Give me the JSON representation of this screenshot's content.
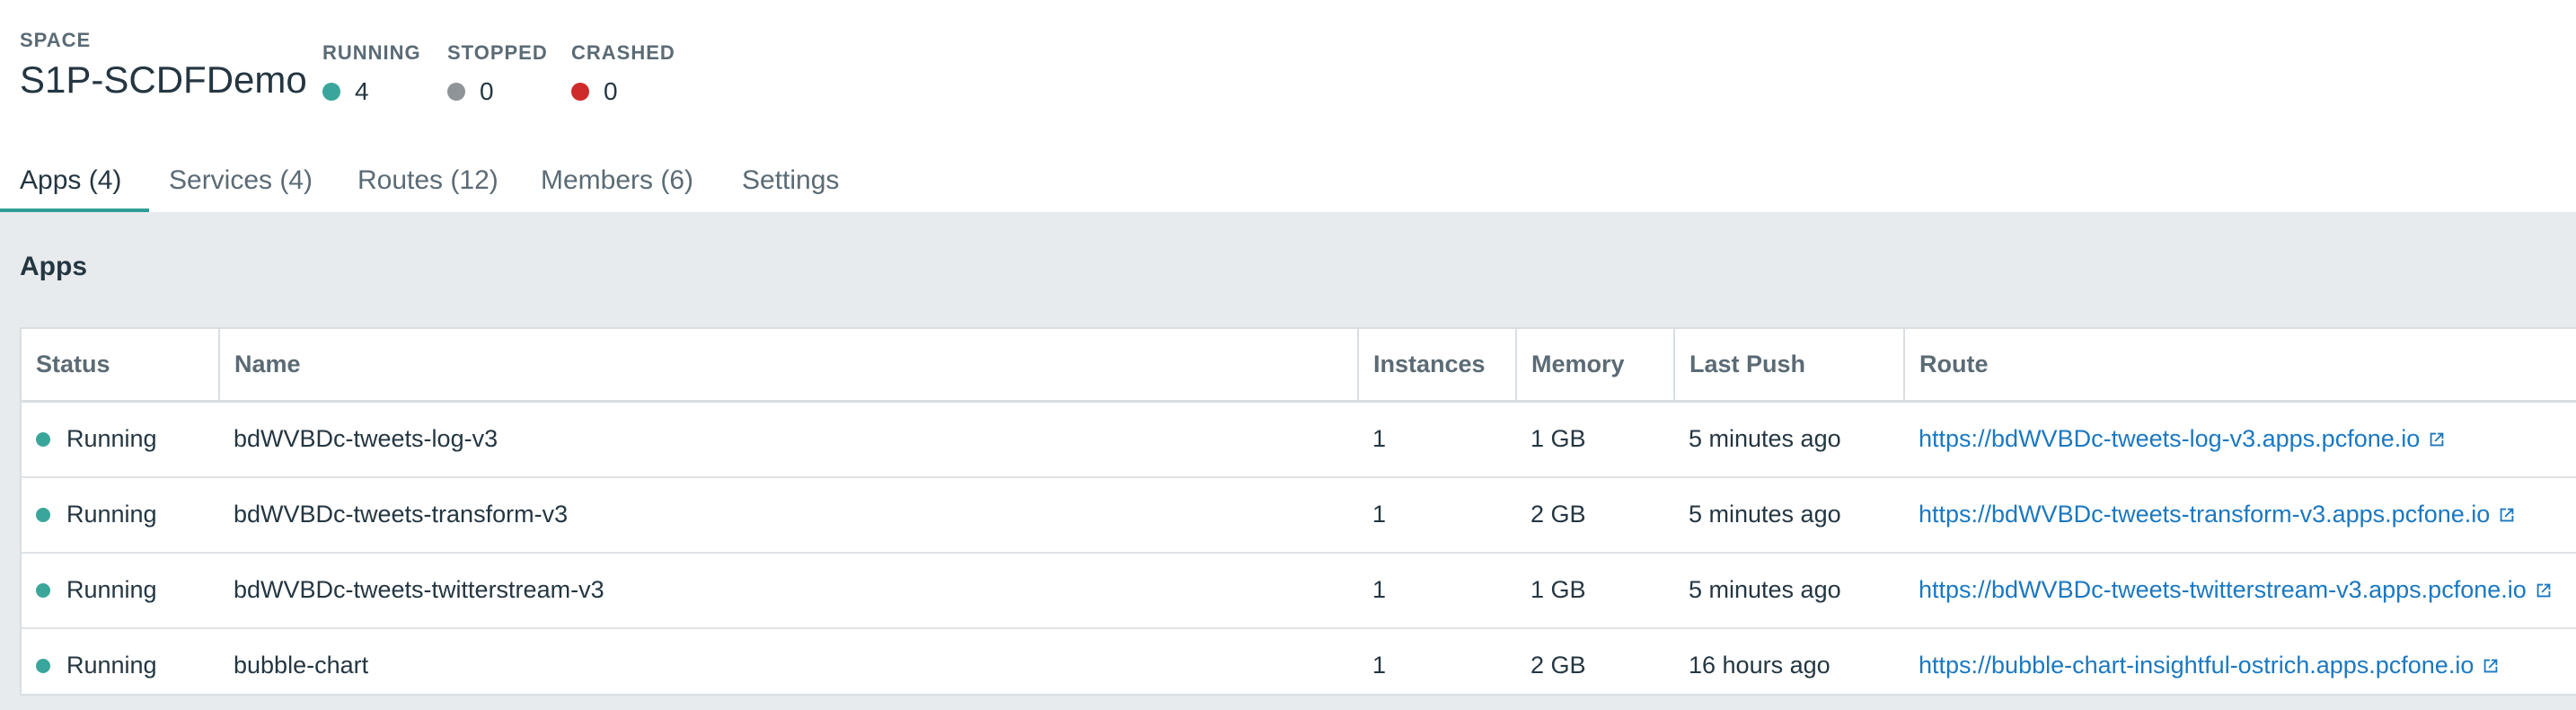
{
  "colors": {
    "running": "#3aa69b",
    "stopped": "#8e9498",
    "crashed": "#cf2b2b",
    "accent": "#2f9f96",
    "link": "#1b78c1",
    "content_bg": "#e8ebed"
  },
  "space": {
    "label": "SPACE",
    "name": "S1P-SCDFDemo"
  },
  "stats": {
    "running": {
      "label": "RUNNING",
      "value": "4"
    },
    "stopped": {
      "label": "STOPPED",
      "value": "0"
    },
    "crashed": {
      "label": "CRASHED",
      "value": "0"
    }
  },
  "tabs": [
    {
      "label": "Apps (4)",
      "active": true
    },
    {
      "label": "Services (4)",
      "active": false
    },
    {
      "label": "Routes (12)",
      "active": false
    },
    {
      "label": "Members (6)",
      "active": false
    },
    {
      "label": "Settings",
      "active": false
    }
  ],
  "section": {
    "title": "Apps"
  },
  "table": {
    "columns": [
      "Status",
      "Name",
      "Instances",
      "Memory",
      "Last Push",
      "Route"
    ],
    "rows": [
      {
        "status": "Running",
        "name": "bdWVBDc-tweets-log-v3",
        "instances": "1",
        "memory": "1 GB",
        "last_push": "5 minutes ago",
        "route": "https://bdWVBDc-tweets-log-v3.apps.pcfone.io"
      },
      {
        "status": "Running",
        "name": "bdWVBDc-tweets-transform-v3",
        "instances": "1",
        "memory": "2 GB",
        "last_push": "5 minutes ago",
        "route": "https://bdWVBDc-tweets-transform-v3.apps.pcfone.io"
      },
      {
        "status": "Running",
        "name": "bdWVBDc-tweets-twitterstream-v3",
        "instances": "1",
        "memory": "1 GB",
        "last_push": "5 minutes ago",
        "route": "https://bdWVBDc-tweets-twitterstream-v3.apps.pcfone.io"
      },
      {
        "status": "Running",
        "name": "bubble-chart",
        "instances": "1",
        "memory": "2 GB",
        "last_push": "16 hours ago",
        "route": "https://bubble-chart-insightful-ostrich.apps.pcfone.io"
      }
    ],
    "external_link_icon": "external-link-icon"
  }
}
